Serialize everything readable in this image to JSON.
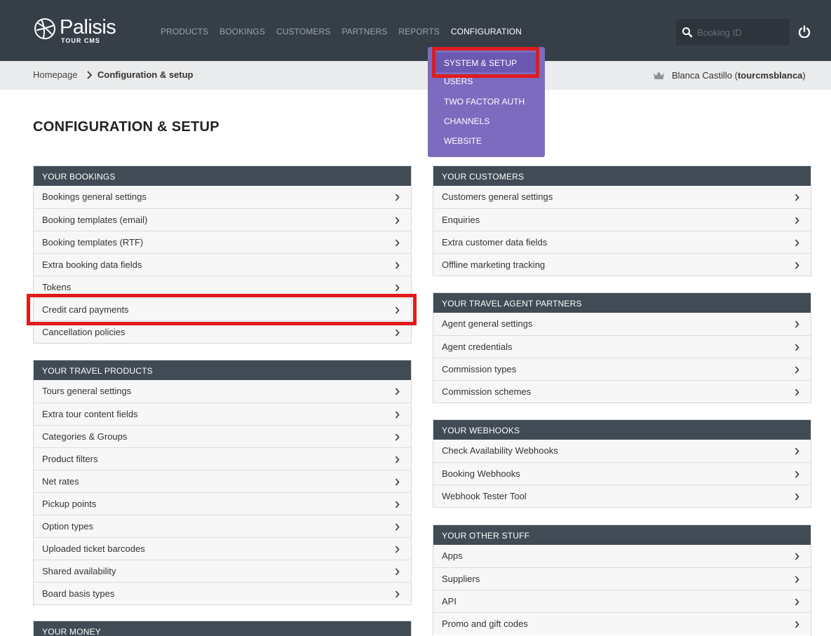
{
  "brand": {
    "name": "Palisis",
    "sub": "TOUR CMS"
  },
  "nav": [
    {
      "label": "PRODUCTS"
    },
    {
      "label": "BOOKINGS"
    },
    {
      "label": "CUSTOMERS"
    },
    {
      "label": "PARTNERS"
    },
    {
      "label": "REPORTS"
    },
    {
      "label": "CONFIGURATION"
    }
  ],
  "search": {
    "placeholder": "Booking ID",
    "value": ""
  },
  "breadcrumb": {
    "home": "Homepage",
    "current": "Configuration & setup"
  },
  "user": {
    "name": "Blanca Castillo (",
    "username": "tourcmsblanca",
    "suffix": ")"
  },
  "page_title": "CONFIGURATION & SETUP",
  "dropdown": [
    {
      "label": "SYSTEM & SETUP"
    },
    {
      "label": "USERS"
    },
    {
      "label": "TWO FACTOR AUTH"
    },
    {
      "label": "CHANNELS"
    },
    {
      "label": "WEBSITE"
    }
  ],
  "panels": {
    "bookings": {
      "title": "YOUR BOOKINGS",
      "items": [
        "Bookings general settings",
        "Booking templates (email)",
        "Booking templates (RTF)",
        "Extra booking data fields",
        "Tokens",
        "Credit card payments",
        "Cancellation policies"
      ]
    },
    "products": {
      "title": "YOUR TRAVEL PRODUCTS",
      "items": [
        "Tours general settings",
        "Extra tour content fields",
        "Categories & Groups",
        "Product filters",
        "Net rates",
        "Pickup points",
        "Option types",
        "Uploaded ticket barcodes",
        "Shared availability",
        "Board basis types"
      ]
    },
    "money": {
      "title": "YOUR MONEY"
    },
    "customers": {
      "title": "YOUR CUSTOMERS",
      "items": [
        "Customers general settings",
        "Enquiries",
        "Extra customer data fields",
        "Offline marketing tracking"
      ]
    },
    "partners": {
      "title": "YOUR TRAVEL AGENT PARTNERS",
      "items": [
        "Agent general settings",
        "Agent credentials",
        "Commission types",
        "Commission schemes"
      ]
    },
    "webhooks": {
      "title": "YOUR WEBHOOKS",
      "items": [
        "Check Availability Webhooks",
        "Booking Webhooks",
        "Webhook Tester Tool"
      ]
    },
    "other": {
      "title": "YOUR OTHER STUFF",
      "items": [
        "Apps",
        "Suppliers",
        "API",
        "Promo and gift codes"
      ]
    }
  },
  "colors": {
    "topbar": "#363f48",
    "dropdown": "#7c6bbf",
    "panel_head": "#414b55",
    "highlight": "#e01b1b"
  }
}
